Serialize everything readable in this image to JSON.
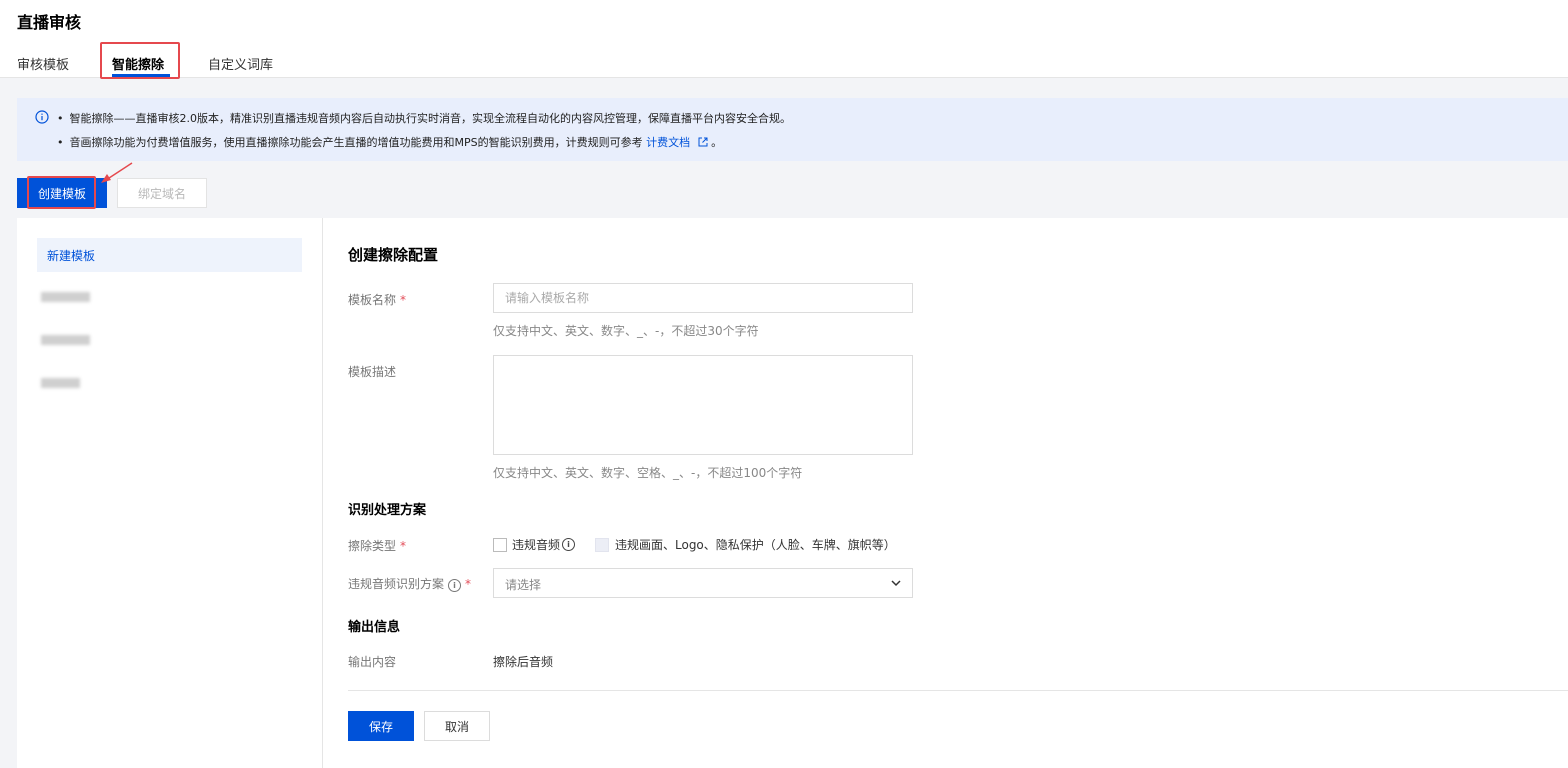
{
  "page": {
    "title": "直播审核"
  },
  "tabs": [
    {
      "label": "审核模板",
      "active": false
    },
    {
      "label": "智能擦除",
      "active": true
    },
    {
      "label": "自定义词库",
      "active": false
    }
  ],
  "notice": {
    "line1": "智能擦除——直播审核2.0版本，精准识别直播违规音频内容后自动执行实时消音，实现全流程自动化的内容风控管理，保障直播平台内容安全合规。",
    "line2_prefix": "音画擦除功能为付费增值服务，使用直播擦除功能会产生直播的增值功能费用和MPS的智能识别费用，计费规则可参考",
    "line2_link": "计费文档",
    "line2_suffix": "。"
  },
  "toolbar": {
    "create_label": "创建模板",
    "bind_label": "绑定域名"
  },
  "sidebar": {
    "items": [
      {
        "label": "新建模板",
        "active": true
      }
    ]
  },
  "form": {
    "title": "创建擦除配置",
    "name_label": "模板名称",
    "name_placeholder": "请输入模板名称",
    "name_help": "仅支持中文、英文、数字、_、-，不超过30个字符",
    "desc_label": "模板描述",
    "desc_help": "仅支持中文、英文、数字、空格、_、-，不超过100个字符",
    "section_recognition": "识别处理方案",
    "erase_type_label": "擦除类型",
    "option_audio": "违规音频",
    "option_video": "违规画面、Logo、隐私保护（人脸、车牌、旗帜等）",
    "audio_scheme_label": "违规音频识别方案",
    "audio_scheme_placeholder": "请选择",
    "section_output": "输出信息",
    "output_content_label": "输出内容",
    "output_content_value": "擦除后音频",
    "save_label": "保存",
    "cancel_label": "取消"
  },
  "colors": {
    "primary": "#0052d9",
    "highlight": "#e5484d",
    "required": "#e34d59",
    "notice_bg": "#e8eefc"
  }
}
